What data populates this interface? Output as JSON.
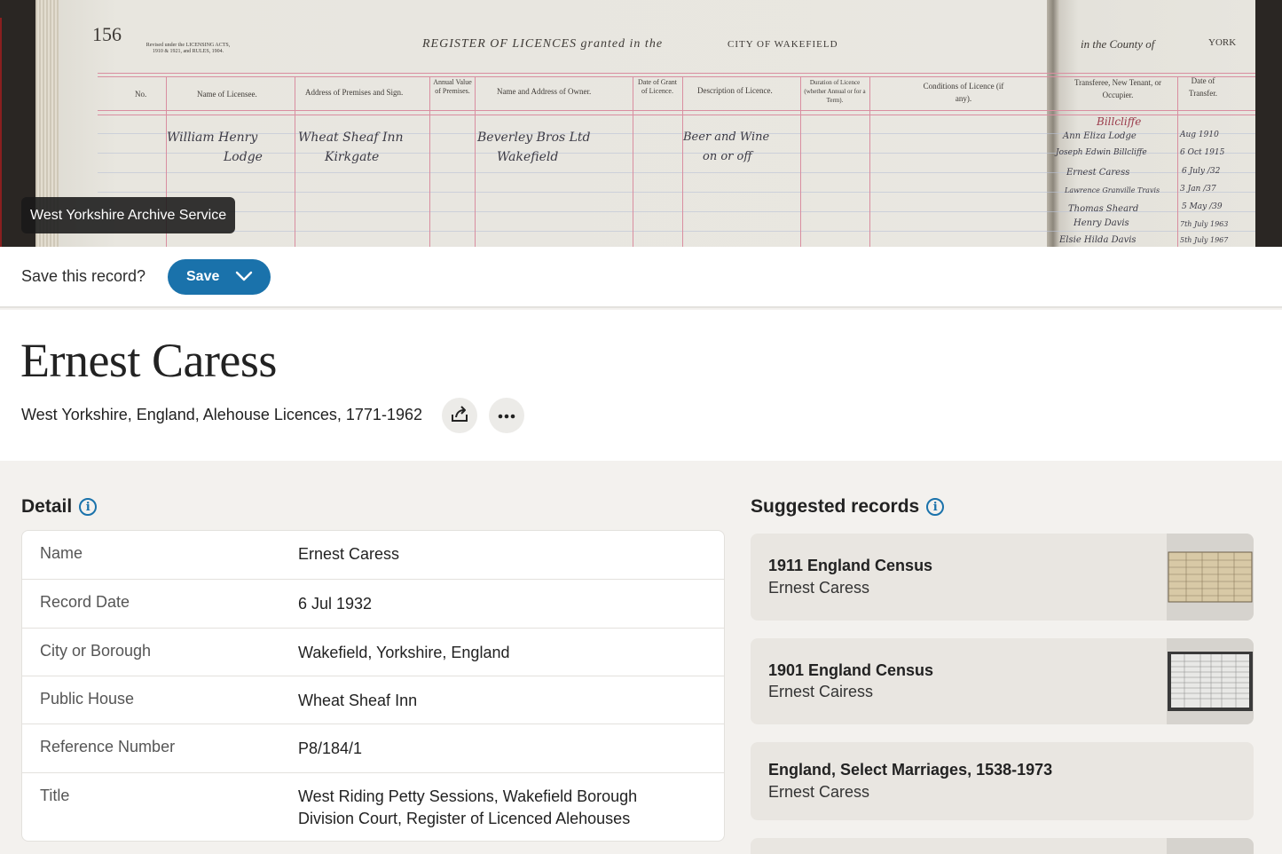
{
  "document_image": {
    "page_number": "156",
    "heading_left": "REGISTER OF LICENCES granted in the",
    "heading_city": "CITY OF WAKEFIELD",
    "heading_right": "in the County of",
    "heading_county": "YORK",
    "small_note": "Revised under the LICENSING ACTS, 1910 & 1921, and RULES, 1904.",
    "columns": [
      "No.",
      "Name of Licensee.",
      "Address of Premises and Sign.",
      "Annual Value of Premises.",
      "Name and Address of Owner.",
      "Date of Grant of Licence.",
      "Description of Licence.",
      "Duration of Licence (whether Annual or for a Term).",
      "Conditions of Licence (if any).",
      "Transferee, New Tenant, or Occupier.",
      "Date of Transfer."
    ],
    "entry": {
      "licensee": [
        "William Henry",
        "Lodge"
      ],
      "premises": [
        "Wheat Sheaf Inn",
        "Kirkgate"
      ],
      "owner": [
        "Beverley Bros Ltd",
        "Wakefield"
      ],
      "description": [
        "Beer and Wine",
        "on or off"
      ]
    },
    "transferees": [
      "Billcliffe",
      "Ann Eliza Lodge",
      "Joseph Edwin Billcliffe",
      "Ernest Caress",
      "Lawrence Granville Travis",
      "Thomas Sheard",
      "Henry Davis",
      "Elsie Hilda Davis"
    ],
    "transfer_dates": [
      "Aug 1910",
      "6 Oct 1915",
      "6 July /32",
      "3 Jan /37",
      "5 May /39",
      "7th July 1963",
      "5th July 1967"
    ],
    "source_badge": "West Yorkshire Archive Service"
  },
  "save_bar": {
    "prompt": "Save this record?",
    "save_label": "Save"
  },
  "record": {
    "name": "Ernest Caress",
    "collection": "West Yorkshire, England, Alehouse Licences, 1771-1962"
  },
  "detail": {
    "heading": "Detail",
    "rows": [
      {
        "label": "Name",
        "value": "Ernest Caress"
      },
      {
        "label": "Record Date",
        "value": "6 Jul 1932"
      },
      {
        "label": "City or Borough",
        "value": "Wakefield, Yorkshire, England"
      },
      {
        "label": "Public House",
        "value": "Wheat Sheaf Inn"
      },
      {
        "label": "Reference Number",
        "value": "P8/184/1"
      },
      {
        "label": "Title",
        "value": "West Riding Petty Sessions, Wakefield Borough Division Court, Register of Licenced Alehouses"
      }
    ]
  },
  "suggested": {
    "heading": "Suggested records",
    "items": [
      {
        "title": "1911 England Census",
        "name": "Ernest Caress"
      },
      {
        "title": "1901 England Census",
        "name": "Ernest Cairess"
      },
      {
        "title": "England, Select Marriages, 1538-1973",
        "name": "Ernest Caress"
      }
    ]
  },
  "colors": {
    "accent": "#1a72ab",
    "page_bg": "#f3f1ee",
    "card_bg": "#ffffff",
    "suggestion_bg": "#e9e6e1"
  },
  "icons": [
    "chevron-down-icon",
    "share-icon",
    "more-icon",
    "info-icon"
  ]
}
